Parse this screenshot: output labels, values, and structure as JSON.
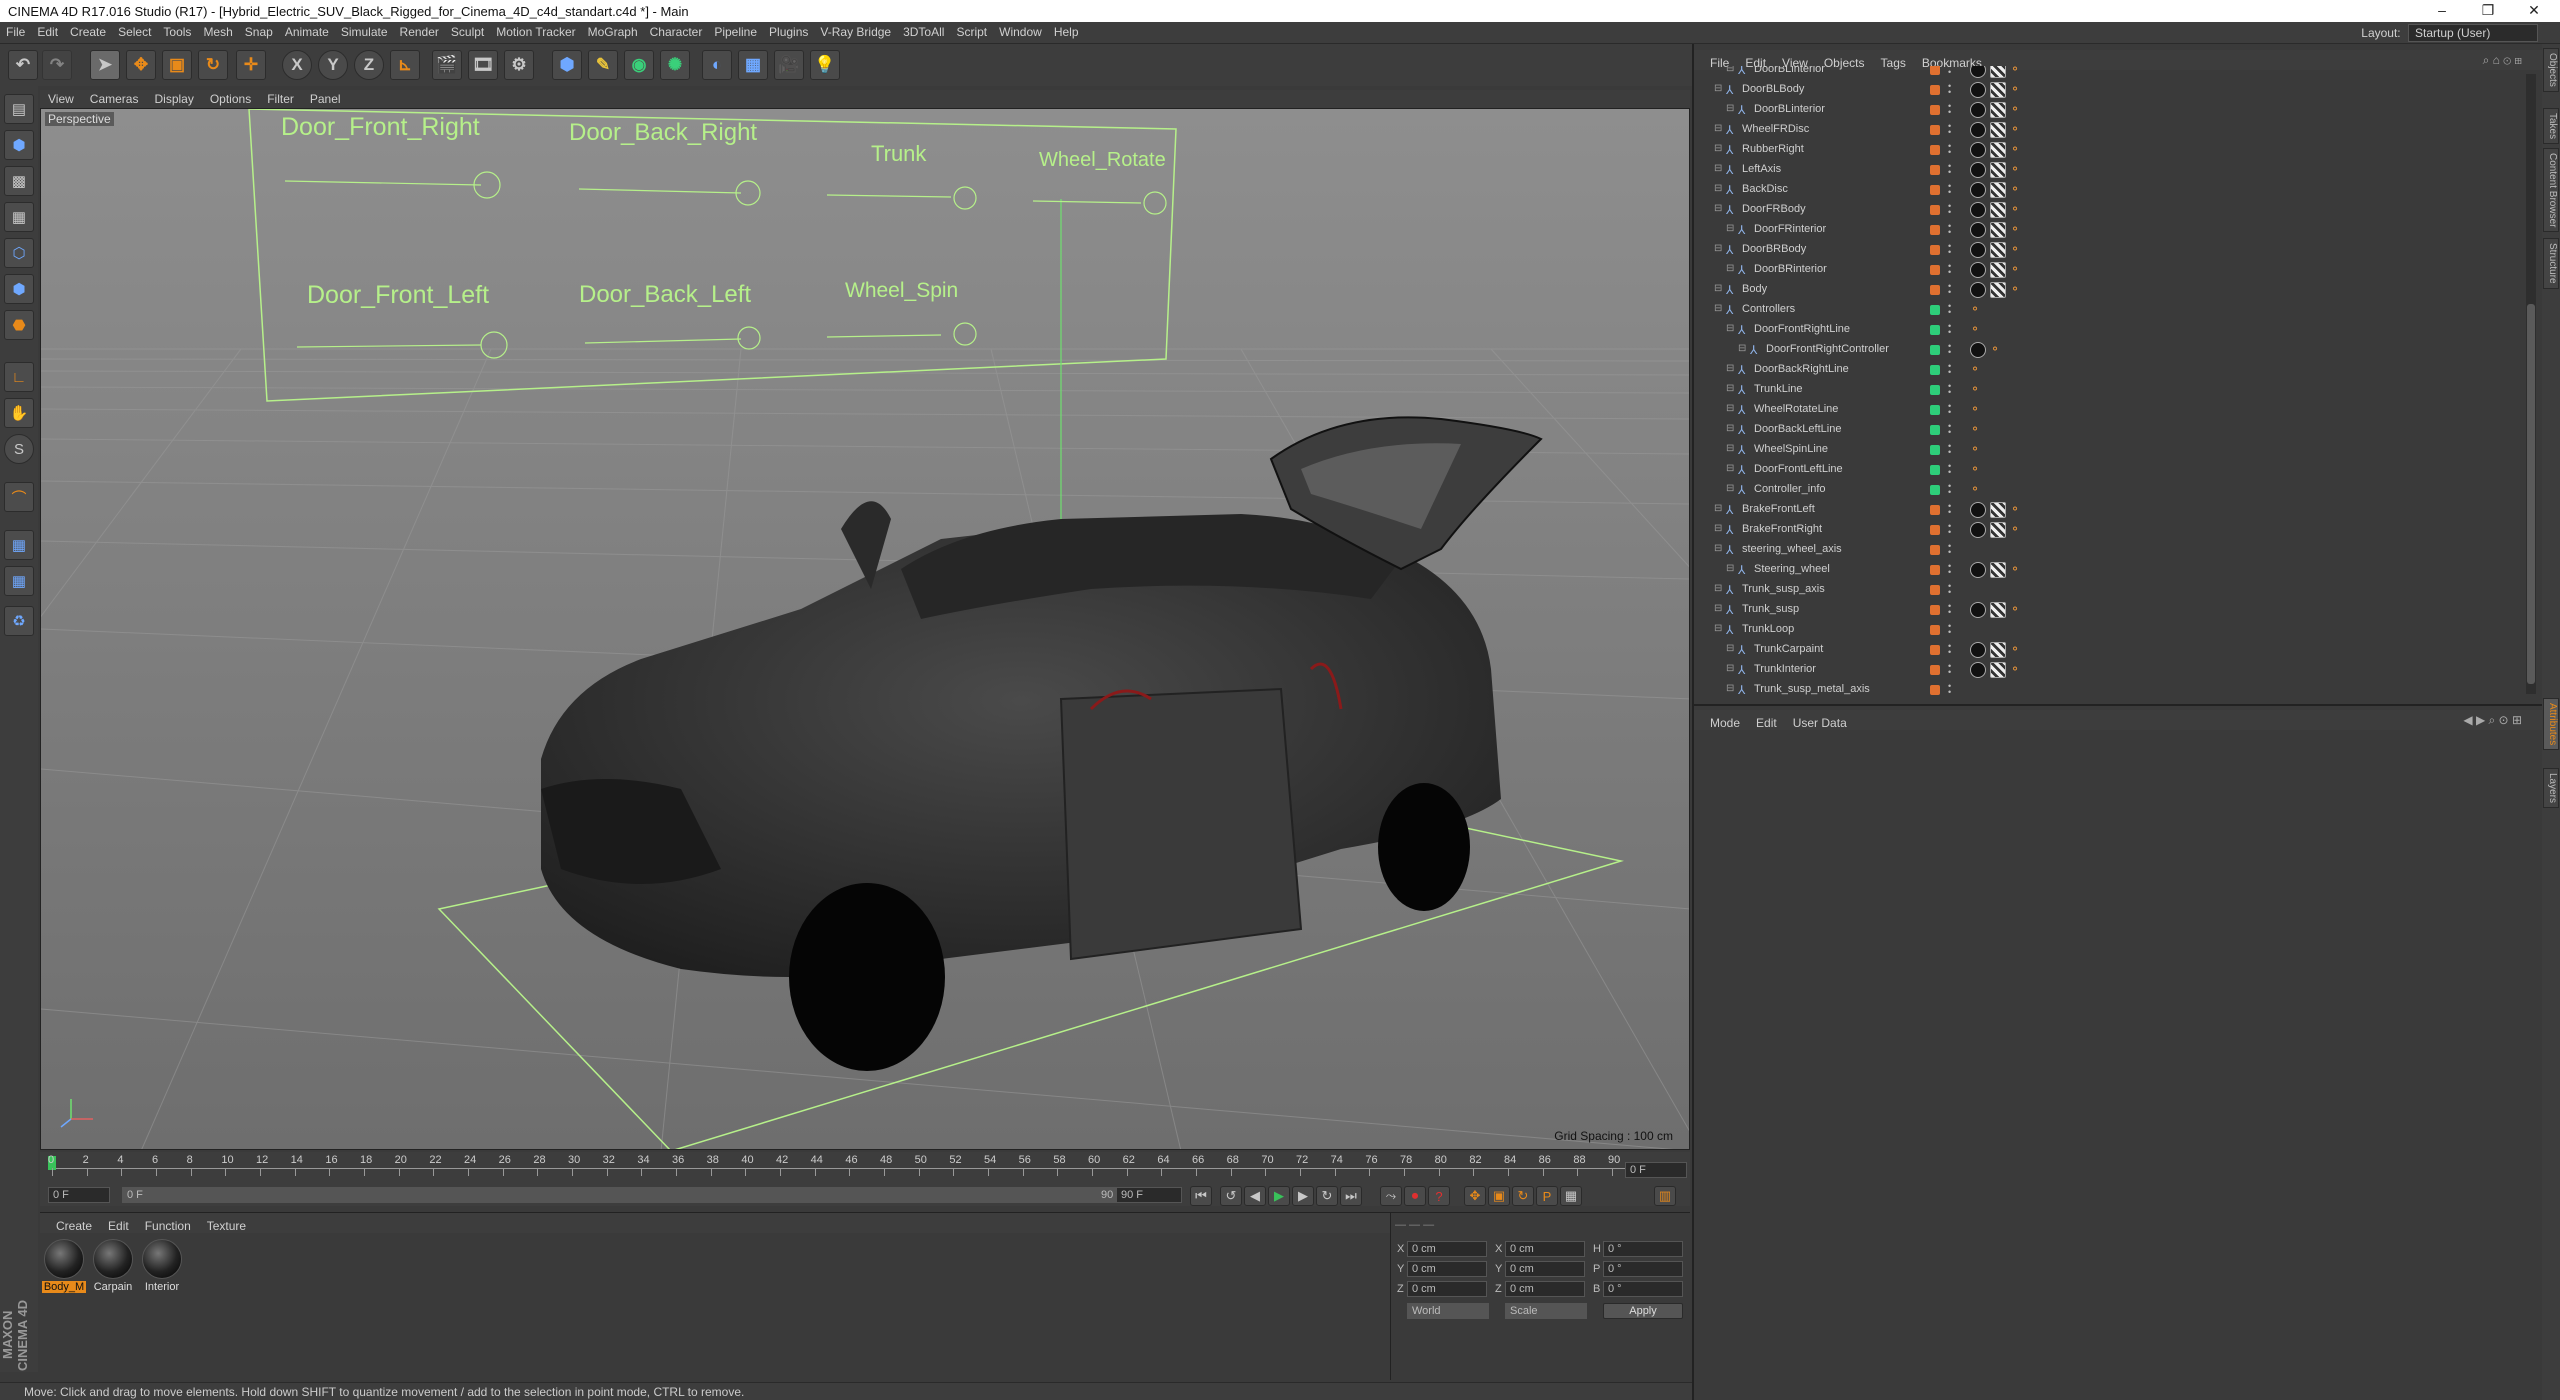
{
  "window": {
    "title": "CINEMA 4D R17.016 Studio (R17) - [Hybrid_Electric_SUV_Black_Rigged_for_Cinema_4D_c4d_standart.c4d *] - Main",
    "minimize": "–",
    "restore": "❐",
    "close": "✕"
  },
  "menu": [
    "File",
    "Edit",
    "Create",
    "Select",
    "Tools",
    "Mesh",
    "Snap",
    "Animate",
    "Simulate",
    "Render",
    "Sculpt",
    "Motion Tracker",
    "MoGraph",
    "Character",
    "Pipeline",
    "Plugins",
    "V-Ray Bridge",
    "3DToAll",
    "Script",
    "Window",
    "Help"
  ],
  "layout": {
    "label": "Layout:",
    "value": "Startup (User)"
  },
  "toolbar": {
    "undo": "↶",
    "redo": "↷",
    "axis_x": "X",
    "axis_y": "Y",
    "axis_z": "Z"
  },
  "viewport": {
    "menu": [
      "View",
      "Cameras",
      "Display",
      "Options",
      "Filter",
      "Panel"
    ],
    "label": "Perspective",
    "grid_spacing": "Grid Spacing : 100 cm",
    "controller_labels": {
      "door_front_right": "Door_Front_Right",
      "door_back_right": "Door_Back_Right",
      "trunk": "Trunk",
      "wheel_rotate": "Wheel_Rotate",
      "door_front_left": "Door_Front_Left",
      "door_back_left": "Door_Back_Left",
      "wheel_spin": "Wheel_Spin"
    }
  },
  "timeline": {
    "ticks": [
      "0",
      "2",
      "4",
      "6",
      "8",
      "10",
      "12",
      "14",
      "16",
      "18",
      "20",
      "22",
      "24",
      "26",
      "28",
      "30",
      "32",
      "34",
      "36",
      "38",
      "40",
      "42",
      "44",
      "46",
      "48",
      "50",
      "52",
      "54",
      "56",
      "58",
      "60",
      "62",
      "64",
      "66",
      "68",
      "70",
      "72",
      "74",
      "76",
      "78",
      "80",
      "82",
      "84",
      "86",
      "88",
      "90"
    ],
    "current_frame": "0 F",
    "start_field": "0 F",
    "slider_start": "0 F",
    "slider_end": "90 F",
    "end_field": "90 F"
  },
  "material_manager": {
    "menu": [
      "Create",
      "Edit",
      "Function",
      "Texture"
    ],
    "materials": [
      {
        "name": "Body_M",
        "selected": true
      },
      {
        "name": "Carpain",
        "selected": false
      },
      {
        "name": "Interior",
        "selected": false
      }
    ]
  },
  "coordinates": {
    "x_pos": "0 cm",
    "y_pos": "0 cm",
    "z_pos": "0 cm",
    "x_size": "0 cm",
    "y_size": "0 cm",
    "z_size": "0 cm",
    "h": "0 °",
    "p": "0 °",
    "b": "0 °",
    "space": "World",
    "mode": "Scale",
    "apply": "Apply",
    "labels": {
      "x": "X",
      "y": "Y",
      "z": "Z",
      "h": "H",
      "p": "P",
      "b": "B"
    }
  },
  "object_manager": {
    "menu": [
      "File",
      "Edit",
      "View",
      "Objects",
      "Tags",
      "Bookmarks"
    ],
    "rows": [
      {
        "name": "DoorBLinterior",
        "indent": 2,
        "color": "#e07030",
        "tags": [
          "b",
          "c",
          "o"
        ]
      },
      {
        "name": "DoorBLBody",
        "indent": 1,
        "color": "#e07030",
        "tags": [
          "b",
          "c",
          "o"
        ]
      },
      {
        "name": "DoorBLinterior",
        "indent": 2,
        "color": "#e07030",
        "tags": [
          "b",
          "c",
          "o"
        ]
      },
      {
        "name": "WheelFRDisc",
        "indent": 1,
        "color": "#e07030",
        "tags": [
          "b",
          "c",
          "o"
        ]
      },
      {
        "name": "RubberRight",
        "indent": 1,
        "color": "#e07030",
        "tags": [
          "b",
          "c",
          "o"
        ]
      },
      {
        "name": "LeftAxis",
        "indent": 1,
        "color": "#e07030",
        "tags": [
          "b",
          "c",
          "o"
        ]
      },
      {
        "name": "BackDisc",
        "indent": 1,
        "color": "#e07030",
        "tags": [
          "b",
          "c",
          "o"
        ]
      },
      {
        "name": "DoorFRBody",
        "indent": 1,
        "color": "#e07030",
        "tags": [
          "b",
          "c",
          "o"
        ]
      },
      {
        "name": "DoorFRinterior",
        "indent": 2,
        "color": "#e07030",
        "tags": [
          "b",
          "c",
          "o"
        ]
      },
      {
        "name": "DoorBRBody",
        "indent": 1,
        "color": "#e07030",
        "tags": [
          "b",
          "c",
          "o"
        ]
      },
      {
        "name": "DoorBRinterior",
        "indent": 2,
        "color": "#e07030",
        "tags": [
          "b",
          "c",
          "o"
        ]
      },
      {
        "name": "Body",
        "indent": 1,
        "color": "#e07030",
        "tags": [
          "b",
          "c",
          "o"
        ]
      },
      {
        "name": "Controllers",
        "indent": 1,
        "color": "#2ecf7a",
        "tags": [
          "o"
        ]
      },
      {
        "name": "DoorFrontRightLine",
        "indent": 2,
        "color": "#2ecf7a",
        "tags": [
          "o"
        ]
      },
      {
        "name": "DoorFrontRightController",
        "indent": 3,
        "color": "#2ecf7a",
        "tags": [
          "x",
          "o"
        ]
      },
      {
        "name": "DoorBackRightLine",
        "indent": 2,
        "color": "#2ecf7a",
        "tags": [
          "o"
        ]
      },
      {
        "name": "TrunkLine",
        "indent": 2,
        "color": "#2ecf7a",
        "tags": [
          "o"
        ]
      },
      {
        "name": "WheelRotateLine",
        "indent": 2,
        "color": "#2ecf7a",
        "tags": [
          "o"
        ]
      },
      {
        "name": "DoorBackLeftLine",
        "indent": 2,
        "color": "#2ecf7a",
        "tags": [
          "o"
        ]
      },
      {
        "name": "WheelSpinLine",
        "indent": 2,
        "color": "#2ecf7a",
        "tags": [
          "o"
        ]
      },
      {
        "name": "DoorFrontLeftLine",
        "indent": 2,
        "color": "#2ecf7a",
        "tags": [
          "o"
        ]
      },
      {
        "name": "Controller_info",
        "indent": 2,
        "color": "#2ecf7a",
        "tags": [
          "o"
        ]
      },
      {
        "name": "BrakeFrontLeft",
        "indent": 1,
        "color": "#e07030",
        "tags": [
          "b",
          "c",
          "o"
        ]
      },
      {
        "name": "BrakeFrontRight",
        "indent": 1,
        "color": "#e07030",
        "tags": [
          "b",
          "c",
          "o"
        ]
      },
      {
        "name": "steering_wheel_axis",
        "indent": 1,
        "color": "#e07030",
        "tags": []
      },
      {
        "name": "Steering_wheel",
        "indent": 2,
        "color": "#e07030",
        "tags": [
          "b",
          "c",
          "o"
        ]
      },
      {
        "name": "Trunk_susp_axis",
        "indent": 1,
        "color": "#e07030",
        "tags": []
      },
      {
        "name": "Trunk_susp",
        "indent": 1,
        "color": "#e07030",
        "tags": [
          "b",
          "c",
          "o"
        ]
      },
      {
        "name": "TrunkLoop",
        "indent": 1,
        "color": "#e07030",
        "tags": []
      },
      {
        "name": "TrunkCarpaint",
        "indent": 2,
        "color": "#e07030",
        "tags": [
          "b",
          "c",
          "o"
        ]
      },
      {
        "name": "TrunkInterior",
        "indent": 2,
        "color": "#e07030",
        "tags": [
          "b",
          "c",
          "o"
        ]
      },
      {
        "name": "Trunk_susp_metal_axis",
        "indent": 2,
        "color": "#e07030",
        "tags": []
      }
    ]
  },
  "attributes": {
    "menu": [
      "Mode",
      "Edit",
      "User Data"
    ]
  },
  "side_tabs": [
    "Objects",
    "Takes",
    "Content Browser",
    "Structure",
    "Attributes",
    "Layers"
  ],
  "status": "Move: Click and drag to move elements. Hold down SHIFT to quantize movement / add to the selection in point mode, CTRL to remove.",
  "maxon": "MAXON CINEMA 4D"
}
